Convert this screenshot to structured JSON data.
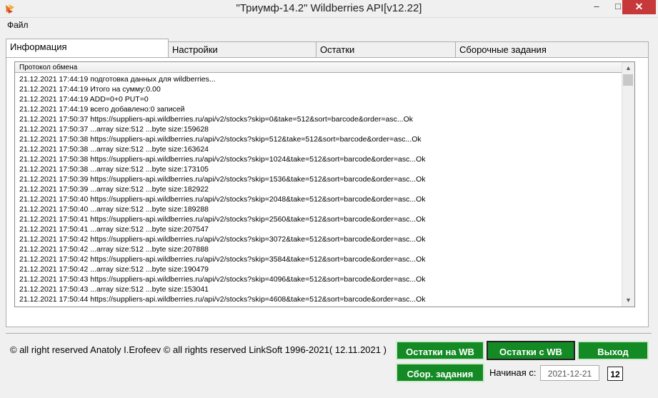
{
  "window": {
    "title": "\"Триумф-14.2\" Wildberries API[v12.22]",
    "minimize": "–",
    "maximize": "□",
    "close": "✕"
  },
  "menu": {
    "file": "Файл"
  },
  "tabs": [
    "Информация",
    "Настройки",
    "Остатки",
    "Сборочные задания"
  ],
  "log": {
    "header": "Протокол обмена",
    "lines": [
      "21.12.2021 17:44:19 подготовка данных для wildberries...",
      "21.12.2021 17:44:19 Итого на сумму:0.00",
      "21.12.2021 17:44:19 ADD=0+0 PUT=0",
      "21.12.2021 17:44:19 всего добавлено:0 записей",
      "21.12.2021 17:50:37 https://suppliers-api.wildberries.ru/api/v2/stocks?skip=0&take=512&sort=barcode&order=asc...Ok",
      "21.12.2021 17:50:37  ...array size:512 ...byte size:159628",
      "21.12.2021 17:50:38 https://suppliers-api.wildberries.ru/api/v2/stocks?skip=512&take=512&sort=barcode&order=asc...Ok",
      "21.12.2021 17:50:38  ...array size:512 ...byte size:163624",
      "21.12.2021 17:50:38 https://suppliers-api.wildberries.ru/api/v2/stocks?skip=1024&take=512&sort=barcode&order=asc...Ok",
      "21.12.2021 17:50:38  ...array size:512 ...byte size:173105",
      "21.12.2021 17:50:39 https://suppliers-api.wildberries.ru/api/v2/stocks?skip=1536&take=512&sort=barcode&order=asc...Ok",
      "21.12.2021 17:50:39  ...array size:512 ...byte size:182922",
      "21.12.2021 17:50:40 https://suppliers-api.wildberries.ru/api/v2/stocks?skip=2048&take=512&sort=barcode&order=asc...Ok",
      "21.12.2021 17:50:40  ...array size:512 ...byte size:189288",
      "21.12.2021 17:50:41 https://suppliers-api.wildberries.ru/api/v2/stocks?skip=2560&take=512&sort=barcode&order=asc...Ok",
      "21.12.2021 17:50:41  ...array size:512 ...byte size:207547",
      "21.12.2021 17:50:42 https://suppliers-api.wildberries.ru/api/v2/stocks?skip=3072&take=512&sort=barcode&order=asc...Ok",
      "21.12.2021 17:50:42  ...array size:512 ...byte size:207888",
      "21.12.2021 17:50:42 https://suppliers-api.wildberries.ru/api/v2/stocks?skip=3584&take=512&sort=barcode&order=asc...Ok",
      "21.12.2021 17:50:42  ...array size:512 ...byte size:190479",
      "21.12.2021 17:50:43 https://suppliers-api.wildberries.ru/api/v2/stocks?skip=4096&take=512&sort=barcode&order=asc...Ok",
      "21.12.2021 17:50:43  ...array size:512 ...byte size:153041",
      "21.12.2021 17:50:44 https://suppliers-api.wildberries.ru/api/v2/stocks?skip=4608&take=512&sort=barcode&order=asc...Ok"
    ]
  },
  "footer": {
    "copyright": "© all right reserved Anatoly I.Erofeev © all rights reserved LinkSoft 1996-2021( 12.11.2021 )",
    "btn_stock_to_wb": "Остатки на WB",
    "btn_stock_from_wb": "Остатки с WB",
    "btn_exit": "Выход",
    "btn_orders": "Сбор. задания",
    "date_label": "Начиная с:",
    "date_value": "2021-12-21",
    "calendar_glyph": "12"
  },
  "colors": {
    "button_green": "#138a24",
    "close_red": "#c7383a"
  },
  "icons": {
    "app": "app-logo-icon",
    "calendar": "calendar-icon",
    "scroll_up": "chevron-up-icon",
    "scroll_down": "chevron-down-icon"
  }
}
